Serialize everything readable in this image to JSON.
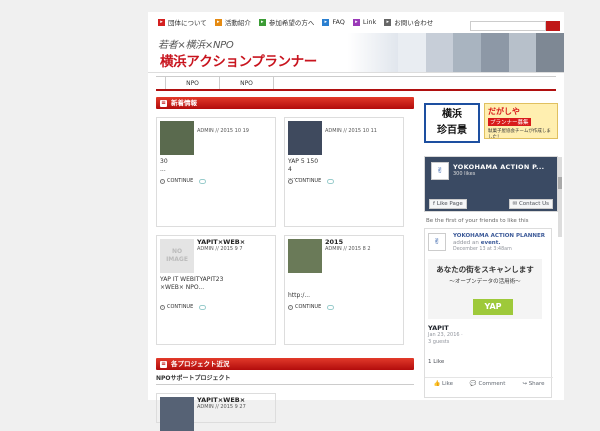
{
  "topnav": {
    "items": [
      {
        "label": "団体について",
        "color": "#d42020"
      },
      {
        "label": "活動紹介",
        "color": "#e58a12"
      },
      {
        "label": "参加希望の方へ",
        "color": "#3c9c36"
      },
      {
        "label": "FAQ",
        "color": "#2a7fd0"
      },
      {
        "label": "Link",
        "color": "#9a3ab8"
      },
      {
        "label": "お問い合わせ",
        "color": "#666666"
      }
    ],
    "search_placeholder": ""
  },
  "banner": {
    "tagline": "若者×横浜×NPO",
    "title": "横浜アクションプランナー"
  },
  "subnav": {
    "items": [
      "NPO",
      "NPO"
    ]
  },
  "main": {
    "news_heading": "新着情報",
    "cards": [
      {
        "title": "",
        "meta": "ADMIN // 2015 10 19",
        "excerpt": "30\n...",
        "continue": "CONTINUE",
        "image": "photo"
      },
      {
        "title": "",
        "meta": "ADMIN // 2015 10 11",
        "excerpt": "YAP                    5 150\n                              4\n......",
        "continue": "CONTINUE",
        "image": "photo"
      },
      {
        "title": "YAPIT×WEB×",
        "meta": "ADMIN // 2015 9 7",
        "excerpt": "YAP IT WEBITYAPIT23\n×WEB×  NPO...",
        "continue": "CONTINUE",
        "image": "noimage",
        "noimage_label": "NO IMAGE"
      },
      {
        "title": "2015",
        "meta": "ADMIN // 2015 8 2",
        "excerpt": "\n\nhttp:/...",
        "continue": "CONTINUE",
        "image": "photo"
      }
    ],
    "projects_heading": "各プロジェクト近況",
    "projects_sub": "NPOサポートプロジェクト",
    "project_card": {
      "title": "YAPIT×WEB×",
      "meta": "ADMIN // 2015 9 27"
    }
  },
  "sidebar": {
    "banner1": "横浜\n珍百景",
    "banner2_text1": "だがしや",
    "banner2_text2": "プランナー募集",
    "banner2_text3": "駄菓子屋協会チームが作成しました！",
    "fb": {
      "name": "YOKOHAMA ACTION P...",
      "likes": "300 likes",
      "like_btn": "Like Page",
      "contact_btn": "Contact Us",
      "friends": "Be the first of your friends to like this",
      "post_name": "YOKOHAMA ACTION PLANNER",
      "post_added": "added an",
      "post_event": "event.",
      "post_date": "December 13 at 3:48am",
      "img_text1": "あなたの街をスキャンします",
      "img_text2": "～オープンデータの活用術～",
      "img_yap": "YAP",
      "event_title": "YAPIT",
      "event_date": "Jan 23, 2016 ·",
      "event_guests": "3 guests",
      "like_count": "1 Like",
      "act_like": "Like",
      "act_comment": "Comment",
      "act_share": "Share"
    }
  }
}
